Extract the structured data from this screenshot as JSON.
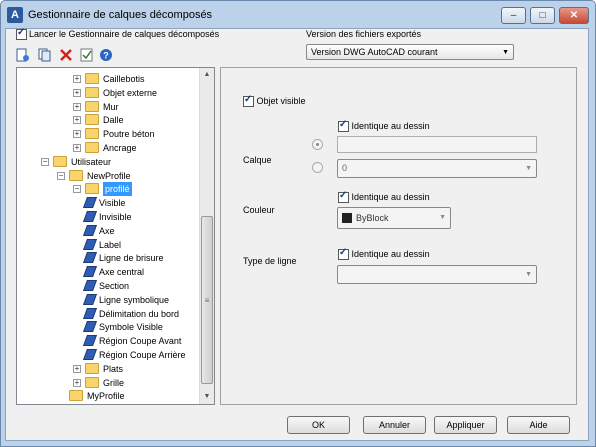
{
  "window": {
    "title": "Gestionnaire de calques décomposés",
    "minimize": "–",
    "maximize": "□",
    "close": "✕"
  },
  "options": {
    "launch_label": "Lancer le Gestionnaire de calques décomposés",
    "launch_checked": true,
    "version_label": "Version des fichiers exportés",
    "version_value": "Version DWG AutoCAD courant"
  },
  "toolbar": [
    "new-icon",
    "copy-icon",
    "delete-icon",
    "check-icon",
    "help-icon"
  ],
  "tree": {
    "items": [
      {
        "label": "Caillebotis",
        "level": 2,
        "expander": "+",
        "kind": "folder-doc"
      },
      {
        "label": "Objet externe",
        "level": 2,
        "expander": "+",
        "kind": "folder-doc"
      },
      {
        "label": "Mur",
        "level": 2,
        "expander": "+",
        "kind": "folder-doc"
      },
      {
        "label": "Dalle",
        "level": 2,
        "expander": "+",
        "kind": "folder-doc"
      },
      {
        "label": "Poutre béton",
        "level": 2,
        "expander": "+",
        "kind": "folder-doc"
      },
      {
        "label": "Ancrage",
        "level": 2,
        "expander": "+",
        "kind": "folder-doc"
      },
      {
        "label": "Utilisateur",
        "level": 0,
        "expander": "−",
        "kind": "folder"
      },
      {
        "label": "NewProfile",
        "level": 1,
        "expander": "−",
        "kind": "folder"
      },
      {
        "label": "profilé",
        "level": 2,
        "expander": "−",
        "kind": "folder-doc",
        "selected": true
      },
      {
        "label": "Visible",
        "level": 3,
        "expander": "",
        "kind": "layer"
      },
      {
        "label": "Invisible",
        "level": 3,
        "expander": "",
        "kind": "layer"
      },
      {
        "label": "Axe",
        "level": 3,
        "expander": "",
        "kind": "layer"
      },
      {
        "label": "Label",
        "level": 3,
        "expander": "",
        "kind": "layer"
      },
      {
        "label": "Ligne de brisure",
        "level": 3,
        "expander": "",
        "kind": "layer"
      },
      {
        "label": "Axe central",
        "level": 3,
        "expander": "",
        "kind": "layer"
      },
      {
        "label": "Section",
        "level": 3,
        "expander": "",
        "kind": "layer"
      },
      {
        "label": "Ligne symbolique",
        "level": 3,
        "expander": "",
        "kind": "layer"
      },
      {
        "label": "Délimitation du bord",
        "level": 3,
        "expander": "",
        "kind": "layer"
      },
      {
        "label": "Symbole Visible",
        "level": 3,
        "expander": "",
        "kind": "layer"
      },
      {
        "label": "Région Coupe Avant",
        "level": 3,
        "expander": "",
        "kind": "layer"
      },
      {
        "label": "Région Coupe Arrière",
        "level": 3,
        "expander": "",
        "kind": "layer"
      },
      {
        "label": "Plats",
        "level": 2,
        "expander": "+",
        "kind": "folder-doc"
      },
      {
        "label": "Grille",
        "level": 2,
        "expander": "+",
        "kind": "folder-doc"
      },
      {
        "label": "MyProfile",
        "level": 1,
        "expander": "",
        "kind": "folder"
      }
    ]
  },
  "panel": {
    "visible_label": "Objet visible",
    "calque_label": "Calque",
    "same_label": "Identique au dessin",
    "layer_select_value": "0",
    "couleur_label": "Couleur",
    "couleur_value": "ByBlock",
    "linetype_label": "Type de ligne",
    "linetype_value": ""
  },
  "buttons": {
    "ok": "OK",
    "cancel": "Annuler",
    "apply": "Appliquer",
    "help": "Aide"
  }
}
